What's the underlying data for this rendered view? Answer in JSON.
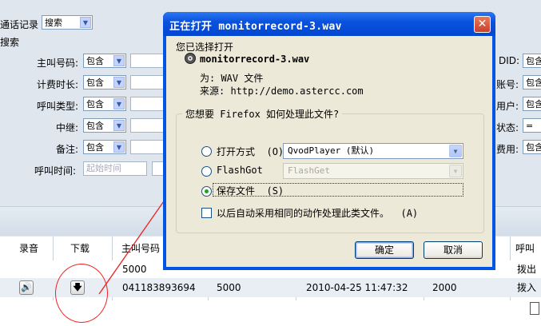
{
  "background": {
    "search_label": "通话记录",
    "search_select": "搜索",
    "sub_label": "搜索",
    "filters_left": [
      {
        "label": "主叫号码:",
        "op": "包含"
      },
      {
        "label": "计费时长:",
        "op": "包含"
      },
      {
        "label": "呼叫类型:",
        "op": "包含"
      },
      {
        "label": "中继:",
        "op": "包含"
      },
      {
        "label": "备注:",
        "op": "包含"
      }
    ],
    "call_time_label": "呼叫时间:",
    "start_time_placeholder": "起始时间",
    "filters_right": [
      {
        "label": "DID:",
        "op": "包含"
      },
      {
        "label": "账号:",
        "op": "包含"
      },
      {
        "label": "用户:",
        "op": "包含"
      },
      {
        "label": "状态:",
        "op": "="
      },
      {
        "label": "费用:",
        "op": "包含"
      }
    ],
    "table": {
      "headers": [
        "录音",
        "下载",
        "主叫号码",
        "呼叫类"
      ],
      "rows": [
        {
          "caller": "5000",
          "type": "拨出"
        },
        {
          "caller": "041183893694",
          "callee": "5000",
          "time": "2010-04-25 11:47:32",
          "ext": "2000",
          "type": "拨入"
        }
      ]
    }
  },
  "dialog": {
    "title": "正在打开 monitorrecord-3.wav",
    "intro": "您已选择打开",
    "filename": "monitorrecord-3.wav",
    "type_line": "为:  WAV 文件",
    "source_line": "来源:  http://demo.astercc.com",
    "question": "您想要 Firefox 如何处理此文件?",
    "options": [
      {
        "label": "打开方式",
        "hotkey": "(O)",
        "combo": "QvodPlayer (默认)",
        "selected": false,
        "enabled": true
      },
      {
        "label": "FlashGot",
        "hotkey": "",
        "combo": "FlashGet",
        "selected": false,
        "enabled": false
      },
      {
        "label": "保存文件",
        "hotkey": "(S)",
        "selected": true
      }
    ],
    "remember_label": "以后自动采用相同的动作处理此类文件。",
    "remember_hotkey": "(A)",
    "ok_label": "确定",
    "cancel_label": "取消",
    "close_glyph": "✕"
  },
  "colors": {
    "title_bar": "#0a52dd",
    "dialog_face": "#ece9d8",
    "annotation_red": "#e22222"
  }
}
